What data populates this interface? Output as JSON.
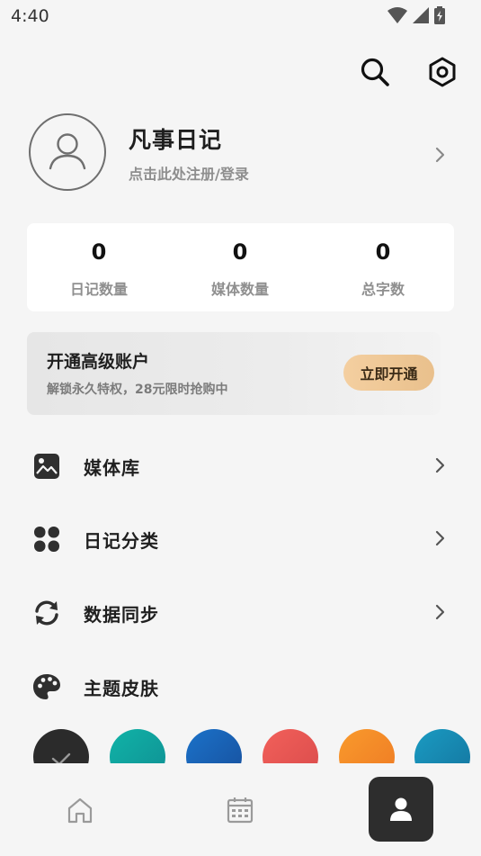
{
  "status_bar": {
    "time": "4:40",
    "icons": [
      "wifi-icon",
      "signal-icon",
      "battery-charging-icon"
    ]
  },
  "top_actions": {
    "icons": [
      "search-icon",
      "settings-hexagon-icon"
    ]
  },
  "profile": {
    "name": "凡事日记",
    "subtitle": "点击此处注册/登录",
    "avatar_icon": "user-icon"
  },
  "stats": [
    {
      "value": "0",
      "label": "日记数量"
    },
    {
      "value": "0",
      "label": "媒体数量"
    },
    {
      "value": "0",
      "label": "总字数"
    }
  ],
  "premium": {
    "title": "开通高级账户",
    "subtitle": "解锁永久特权，28元限时抢购中",
    "button_label": "立即开通"
  },
  "menu": [
    {
      "label": "媒体库",
      "icon": "image-icon",
      "has_chevron": true
    },
    {
      "label": "日记分类",
      "icon": "grid-clover-icon",
      "has_chevron": true
    },
    {
      "label": "数据同步",
      "icon": "sync-icon",
      "has_chevron": true
    },
    {
      "label": "主题皮肤",
      "icon": "palette-icon",
      "has_chevron": false
    }
  ],
  "theme_swatches": [
    {
      "color": "#2b2b2b",
      "selected": true
    },
    {
      "color": "#13a29c",
      "selected": false
    },
    {
      "color": "#1e63b4",
      "selected": false
    },
    {
      "color": "#ea5a55",
      "selected": false
    },
    {
      "color": "#f3892a",
      "selected": false
    },
    {
      "color": "#1487b0",
      "selected": false
    }
  ],
  "bottom_nav": [
    {
      "icon": "home-icon",
      "active": false
    },
    {
      "icon": "calendar-icon",
      "active": false
    },
    {
      "icon": "profile-icon",
      "active": true
    }
  ],
  "colors": {
    "background": "#f5f5f5",
    "active_nav": "#2d2d2d",
    "premium_button": "#efc895"
  }
}
